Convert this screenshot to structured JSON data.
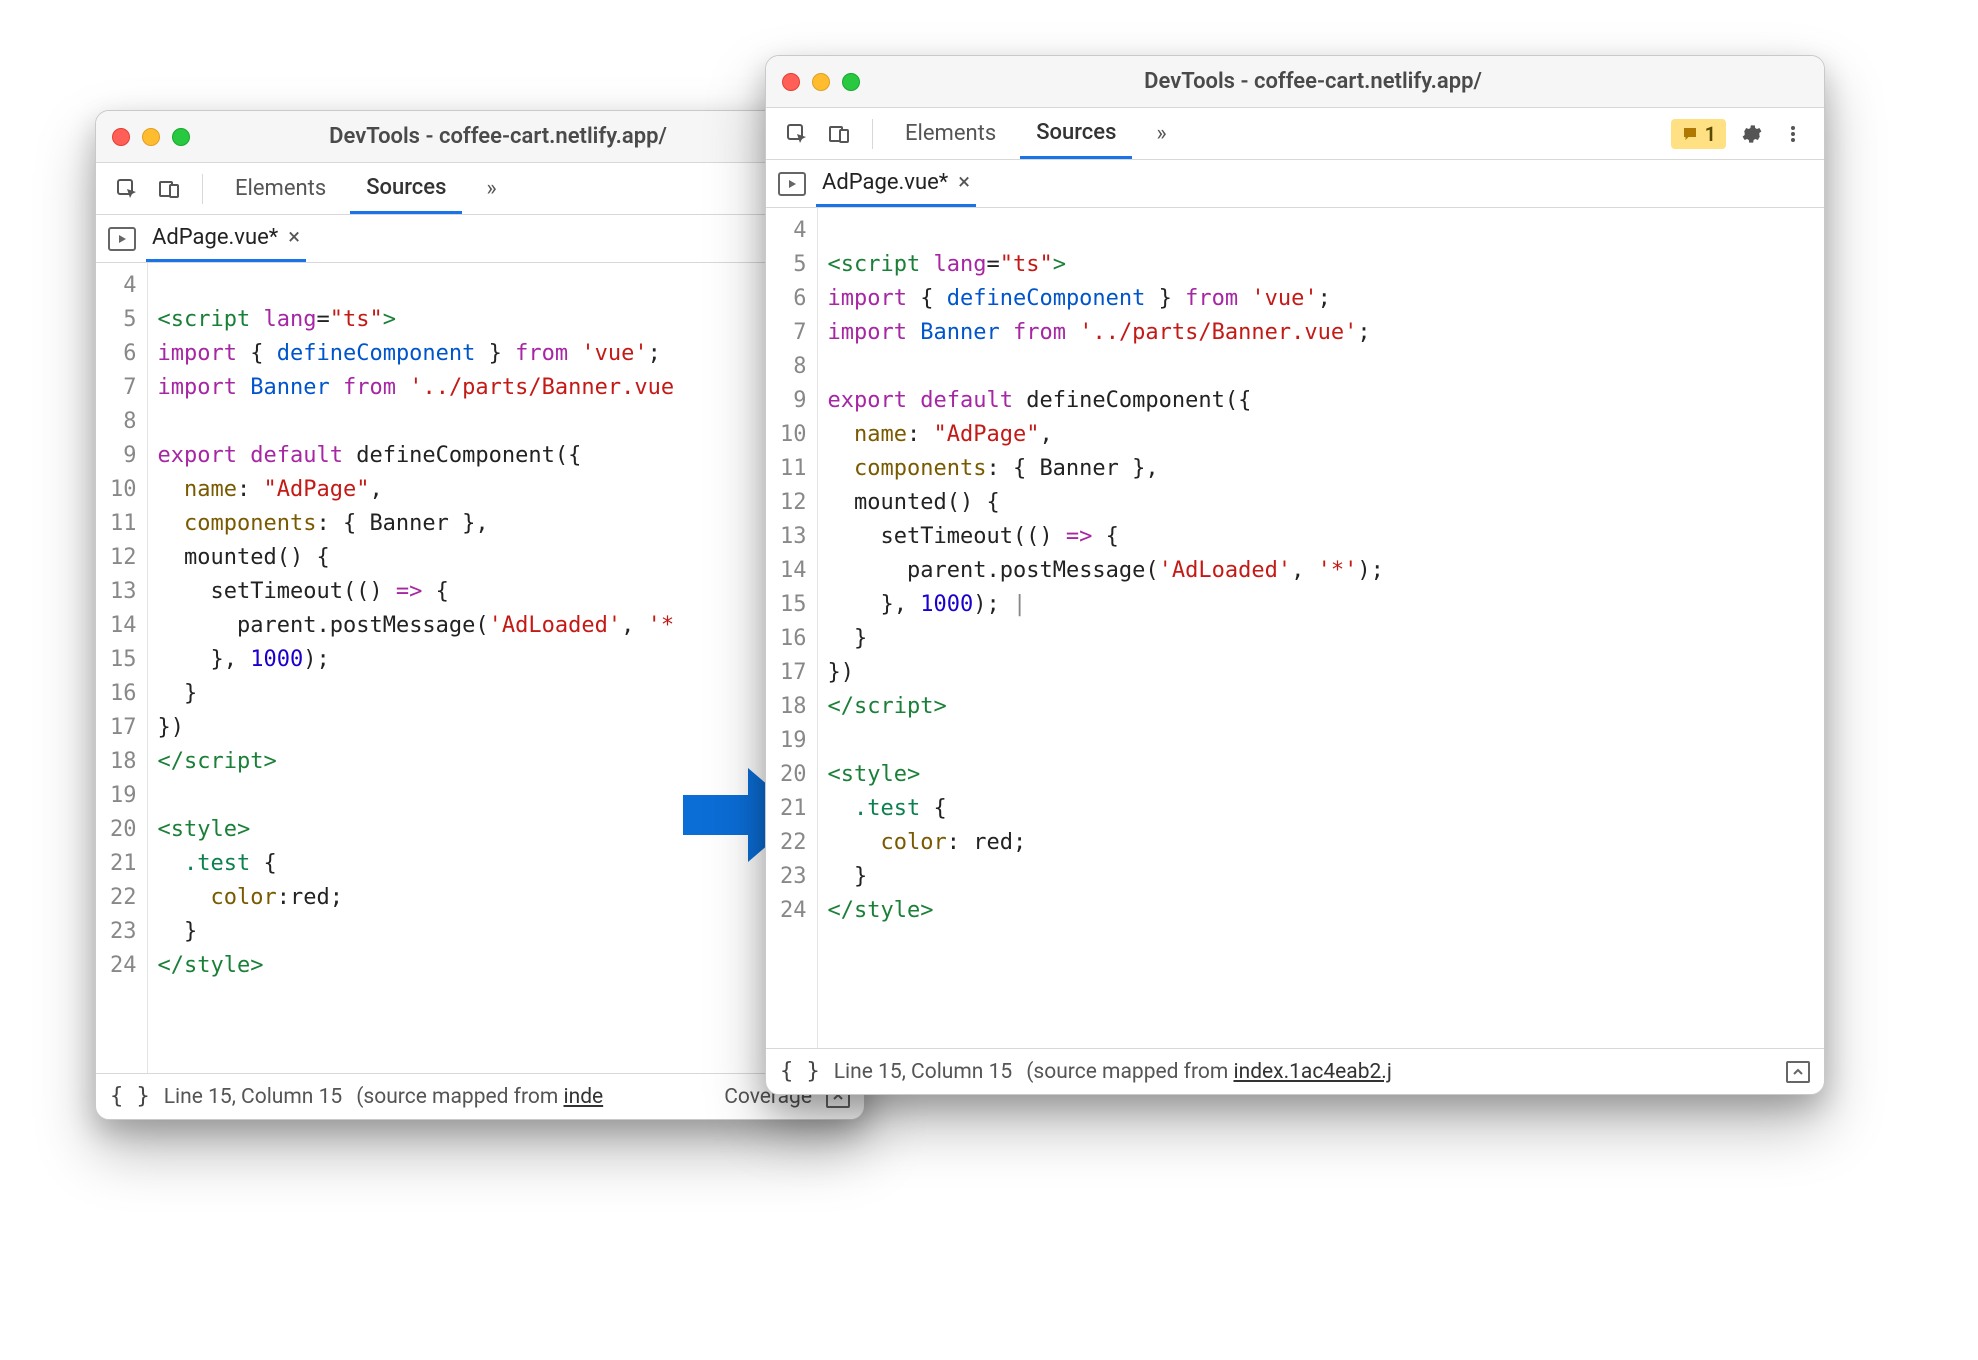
{
  "window_title": "DevTools - coffee-cart.netlify.app/",
  "tabs": {
    "elements": "Elements",
    "sources": "Sources",
    "more": "»"
  },
  "issues_badge_count": "1",
  "filetab": {
    "name": "AdPage.vue*"
  },
  "status": {
    "line_col": "Line 15, Column 15",
    "mapped_prefix": "(source mapped from ",
    "mapped_link_left": "inde",
    "mapped_link_right": "index.1ac4eab2.j",
    "coverage": "Coverage"
  },
  "gutter_start": 4,
  "gutter_end": 24,
  "code_lines_left": [
    [],
    [
      [
        "tag",
        "<script"
      ],
      [
        "punc",
        " "
      ],
      [
        "attr",
        "lang"
      ],
      [
        "punc",
        "="
      ],
      [
        "str",
        "\"ts\""
      ],
      [
        "tag",
        ">"
      ]
    ],
    [
      [
        "kw",
        "import"
      ],
      [
        "punc",
        " { "
      ],
      [
        "id",
        "defineComponent"
      ],
      [
        "punc",
        " } "
      ],
      [
        "kw",
        "from"
      ],
      [
        "punc",
        " "
      ],
      [
        "str",
        "'vue'"
      ],
      [
        "punc",
        ";"
      ]
    ],
    [
      [
        "kw",
        "import"
      ],
      [
        "punc",
        " "
      ],
      [
        "id",
        "Banner"
      ],
      [
        "punc",
        " "
      ],
      [
        "kw",
        "from"
      ],
      [
        "punc",
        " "
      ],
      [
        "str",
        "'../parts/Banner.vue"
      ]
    ],
    [],
    [
      [
        "kw",
        "export"
      ],
      [
        "punc",
        " "
      ],
      [
        "kw",
        "default"
      ],
      [
        "punc",
        " "
      ],
      [
        "fn",
        "defineComponent"
      ],
      [
        "punc",
        "("
      ],
      [
        "punc",
        "{"
      ]
    ],
    [
      [
        "punc",
        "  "
      ],
      [
        "prop",
        "name"
      ],
      [
        "punc",
        ": "
      ],
      [
        "str",
        "\"AdPage\""
      ],
      [
        "punc",
        ","
      ]
    ],
    [
      [
        "punc",
        "  "
      ],
      [
        "prop",
        "components"
      ],
      [
        "punc",
        ": { "
      ],
      [
        "fn",
        "Banner"
      ],
      [
        "punc",
        " },"
      ]
    ],
    [
      [
        "punc",
        "  "
      ],
      [
        "fn",
        "mounted"
      ],
      [
        "punc",
        "() {"
      ]
    ],
    [
      [
        "punc",
        "    "
      ],
      [
        "fn",
        "setTimeout"
      ],
      [
        "punc",
        "(() "
      ],
      [
        "kw",
        "=>"
      ],
      [
        "punc",
        " {"
      ]
    ],
    [
      [
        "punc",
        "      "
      ],
      [
        "fn",
        "parent"
      ],
      [
        "punc",
        "."
      ],
      [
        "fn",
        "postMessage"
      ],
      [
        "punc",
        "("
      ],
      [
        "str",
        "'AdLoaded'"
      ],
      [
        "punc",
        ", "
      ],
      [
        "str",
        "'*"
      ]
    ],
    [
      [
        "punc",
        "    }, "
      ],
      [
        "num",
        "1000"
      ],
      [
        "punc",
        ");"
      ]
    ],
    [
      [
        "punc",
        "  }"
      ]
    ],
    [
      [
        "punc",
        "})"
      ]
    ],
    [
      [
        "tag",
        "</script"
      ],
      [
        "tag",
        ">"
      ]
    ],
    [],
    [
      [
        "tag",
        "<style>"
      ]
    ],
    [
      [
        "punc",
        "  "
      ],
      [
        "css",
        ".test"
      ],
      [
        "punc",
        " {"
      ]
    ],
    [
      [
        "punc",
        "    "
      ],
      [
        "prop",
        "color"
      ],
      [
        "punc",
        ":"
      ],
      [
        "fn",
        "red"
      ],
      [
        "punc",
        ";"
      ]
    ],
    [
      [
        "punc",
        "  }"
      ]
    ],
    [
      [
        "tag",
        "</style>"
      ]
    ]
  ],
  "code_lines_right": [
    [],
    [
      [
        "tag",
        "<script"
      ],
      [
        "punc",
        " "
      ],
      [
        "attr",
        "lang"
      ],
      [
        "punc",
        "="
      ],
      [
        "str",
        "\"ts\""
      ],
      [
        "tag",
        ">"
      ]
    ],
    [
      [
        "kw",
        "import"
      ],
      [
        "punc",
        " { "
      ],
      [
        "id",
        "defineComponent"
      ],
      [
        "punc",
        " } "
      ],
      [
        "kw",
        "from"
      ],
      [
        "punc",
        " "
      ],
      [
        "str",
        "'vue'"
      ],
      [
        "punc",
        ";"
      ]
    ],
    [
      [
        "kw",
        "import"
      ],
      [
        "punc",
        " "
      ],
      [
        "id",
        "Banner"
      ],
      [
        "punc",
        " "
      ],
      [
        "kw",
        "from"
      ],
      [
        "punc",
        " "
      ],
      [
        "str",
        "'../parts/Banner.vue'"
      ],
      [
        "punc",
        ";"
      ]
    ],
    [],
    [
      [
        "kw",
        "export"
      ],
      [
        "punc",
        " "
      ],
      [
        "kw",
        "default"
      ],
      [
        "punc",
        " "
      ],
      [
        "fn",
        "defineComponent"
      ],
      [
        "punc",
        "("
      ],
      [
        "punc",
        "{"
      ]
    ],
    [
      [
        "punc",
        "  "
      ],
      [
        "prop",
        "name"
      ],
      [
        "punc",
        ": "
      ],
      [
        "str",
        "\"AdPage\""
      ],
      [
        "punc",
        ","
      ]
    ],
    [
      [
        "punc",
        "  "
      ],
      [
        "prop",
        "components"
      ],
      [
        "punc",
        ": { "
      ],
      [
        "fn",
        "Banner"
      ],
      [
        "punc",
        " },"
      ]
    ],
    [
      [
        "punc",
        "  "
      ],
      [
        "fn",
        "mounted"
      ],
      [
        "punc",
        "() {"
      ]
    ],
    [
      [
        "punc",
        "    "
      ],
      [
        "fn",
        "setTimeout"
      ],
      [
        "punc",
        "(() "
      ],
      [
        "kw",
        "=>"
      ],
      [
        "punc",
        " {"
      ]
    ],
    [
      [
        "punc",
        "      "
      ],
      [
        "fn",
        "parent"
      ],
      [
        "punc",
        "."
      ],
      [
        "fn",
        "postMessage"
      ],
      [
        "punc",
        "("
      ],
      [
        "str",
        "'AdLoaded'"
      ],
      [
        "punc",
        ", "
      ],
      [
        "str",
        "'*'"
      ],
      [
        "punc",
        ");"
      ]
    ],
    [
      [
        "punc",
        "    }, "
      ],
      [
        "num",
        "1000"
      ],
      [
        "punc",
        ");"
      ],
      [
        "cursor",
        " |"
      ]
    ],
    [
      [
        "punc",
        "  }"
      ]
    ],
    [
      [
        "punc",
        "})"
      ]
    ],
    [
      [
        "tag",
        "</script"
      ],
      [
        "tag",
        ">"
      ]
    ],
    [],
    [
      [
        "tag",
        "<style>"
      ]
    ],
    [
      [
        "punc",
        "  "
      ],
      [
        "css",
        ".test"
      ],
      [
        "punc",
        " {"
      ]
    ],
    [
      [
        "punc",
        "    "
      ],
      [
        "prop",
        "color"
      ],
      [
        "punc",
        ": "
      ],
      [
        "fn",
        "red"
      ],
      [
        "punc",
        ";"
      ]
    ],
    [
      [
        "punc",
        "  }"
      ]
    ],
    [
      [
        "tag",
        "</style>"
      ]
    ]
  ]
}
